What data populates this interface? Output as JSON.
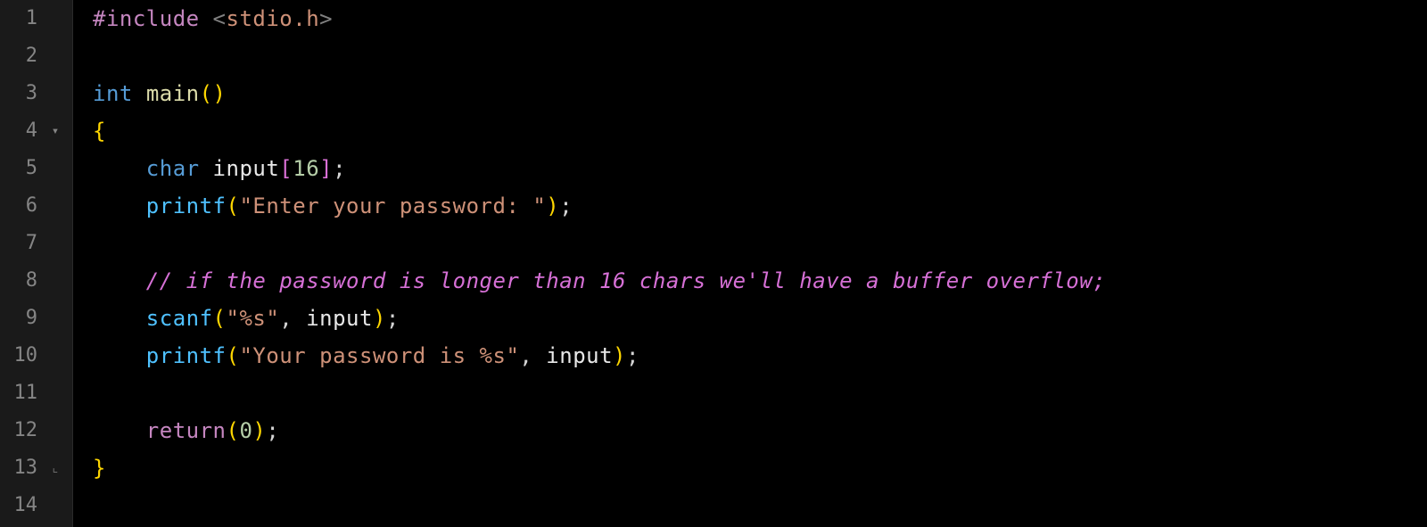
{
  "gutter": {
    "lines": [
      {
        "num": "1",
        "marker": ""
      },
      {
        "num": "2",
        "marker": ""
      },
      {
        "num": "3",
        "marker": ""
      },
      {
        "num": "4",
        "marker": "▾"
      },
      {
        "num": "5",
        "marker": ""
      },
      {
        "num": "6",
        "marker": ""
      },
      {
        "num": "7",
        "marker": ""
      },
      {
        "num": "8",
        "marker": ""
      },
      {
        "num": "9",
        "marker": ""
      },
      {
        "num": "10",
        "marker": ""
      },
      {
        "num": "11",
        "marker": ""
      },
      {
        "num": "12",
        "marker": ""
      },
      {
        "num": "13",
        "marker": "⌞"
      },
      {
        "num": "14",
        "marker": ""
      }
    ]
  },
  "code": {
    "line1": {
      "include": "#include",
      "space": " ",
      "lt": "<",
      "header": "stdio.h",
      "gt": ">"
    },
    "line3": {
      "int": "int",
      "space": " ",
      "main": "main",
      "parens": "()"
    },
    "line4": {
      "brace": "{"
    },
    "line5": {
      "indent": "    ",
      "char": "char",
      "space1": " ",
      "input": "input",
      "lbracket": "[",
      "size": "16",
      "rbracket": "]",
      "semi": ";"
    },
    "line6": {
      "indent": "    ",
      "printf": "printf",
      "lparen": "(",
      "str": "\"Enter your password: \"",
      "rparen": ")",
      "semi": ";"
    },
    "line8": {
      "indent": "    ",
      "comment": "// if the password is longer than 16 chars we'll have a buffer overflow;"
    },
    "line9": {
      "indent": "    ",
      "scanf": "scanf",
      "lparen": "(",
      "fmt": "\"%s\"",
      "comma": ", ",
      "input": "input",
      "rparen": ")",
      "semi": ";"
    },
    "line10": {
      "indent": "    ",
      "printf": "printf",
      "lparen": "(",
      "str": "\"Your password is %s\"",
      "comma": ", ",
      "input": "input",
      "rparen": ")",
      "semi": ";"
    },
    "line12": {
      "indent": "    ",
      "return": "return",
      "lparen": "(",
      "zero": "0",
      "rparen": ")",
      "semi": ";"
    },
    "line13": {
      "brace": "}"
    }
  }
}
